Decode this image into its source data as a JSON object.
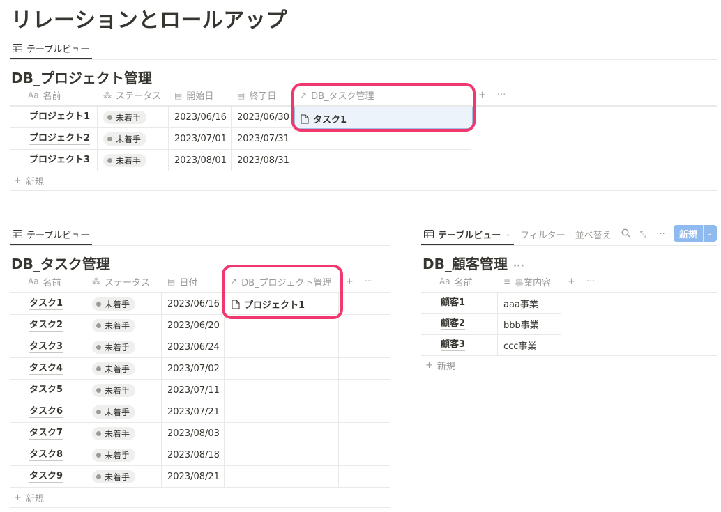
{
  "page": {
    "title": "リレーションとロールアップ"
  },
  "project_db": {
    "view_tab": "テーブルビュー",
    "title": "DB_プロジェクト管理",
    "columns": {
      "name": "名前",
      "status": "ステータス",
      "start": "開始日",
      "end": "終了日",
      "relation": "DB_タスク管理"
    },
    "rows": [
      {
        "name": "プロジェクト1",
        "status": "未着手",
        "start": "2023/06/16",
        "end": "2023/06/30",
        "relation": "タスク1"
      },
      {
        "name": "プロジェクト2",
        "status": "未着手",
        "start": "2023/07/01",
        "end": "2023/07/31",
        "relation": ""
      },
      {
        "name": "プロジェクト3",
        "status": "未着手",
        "start": "2023/08/01",
        "end": "2023/08/31",
        "relation": ""
      }
    ],
    "new_label": "新規"
  },
  "task_db": {
    "view_tab": "テーブルビュー",
    "title": "DB_タスク管理",
    "columns": {
      "name": "名前",
      "status": "ステータス",
      "date": "日付",
      "relation": "DB_プロジェクト管理"
    },
    "rows": [
      {
        "name": "タスク1",
        "status": "未着手",
        "date": "2023/06/16",
        "relation": "プロジェクト1"
      },
      {
        "name": "タスク2",
        "status": "未着手",
        "date": "2023/06/20",
        "relation": ""
      },
      {
        "name": "タスク3",
        "status": "未着手",
        "date": "2023/06/24",
        "relation": ""
      },
      {
        "name": "タスク4",
        "status": "未着手",
        "date": "2023/07/02",
        "relation": ""
      },
      {
        "name": "タスク5",
        "status": "未着手",
        "date": "2023/07/11",
        "relation": ""
      },
      {
        "name": "タスク6",
        "status": "未着手",
        "date": "2023/07/21",
        "relation": ""
      },
      {
        "name": "タスク7",
        "status": "未着手",
        "date": "2023/08/03",
        "relation": ""
      },
      {
        "name": "タスク8",
        "status": "未着手",
        "date": "2023/08/18",
        "relation": ""
      },
      {
        "name": "タスク9",
        "status": "未着手",
        "date": "2023/08/21",
        "relation": ""
      }
    ],
    "new_label": "新規"
  },
  "customer_db": {
    "view_tab": "テーブルビュー",
    "filter_label": "フィルター",
    "sort_label": "並べ替え",
    "new_button": "新規",
    "title": "DB_顧客管理",
    "columns": {
      "name": "名前",
      "business": "事業内容"
    },
    "rows": [
      {
        "name": "顧客1",
        "business": "aaa事業"
      },
      {
        "name": "顧客2",
        "business": "bbb事業"
      },
      {
        "name": "顧客3",
        "business": "ccc事業"
      }
    ],
    "new_label": "新規"
  },
  "colors": {
    "highlight": "#f0376e",
    "new_button": "#8fbaf0",
    "status_dot": "#9b9a97"
  }
}
